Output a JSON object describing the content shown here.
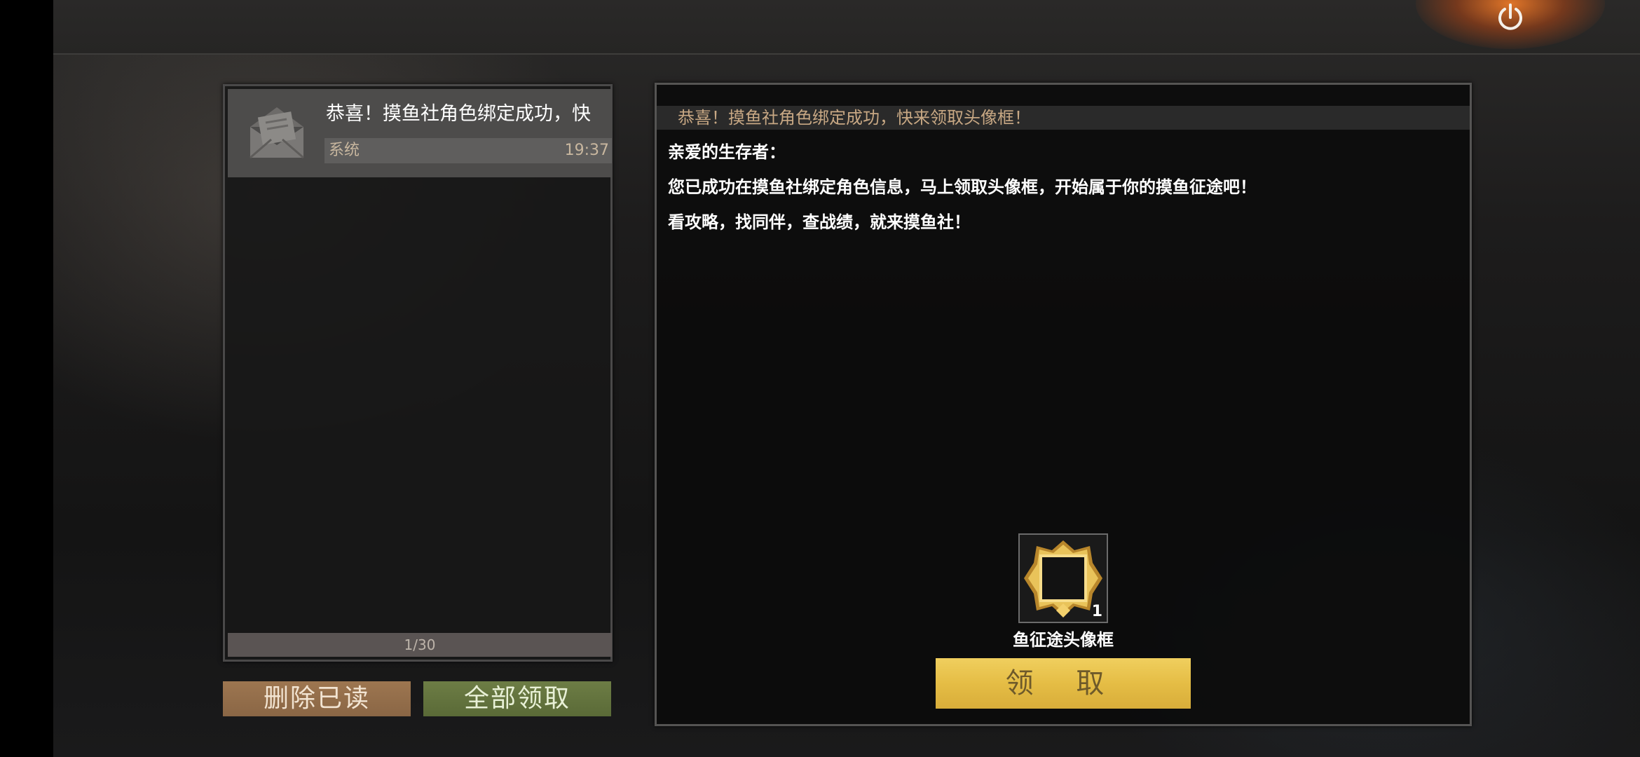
{
  "mail_list": {
    "items": [
      {
        "title": "恭喜！摸鱼社角色绑定成功，快",
        "sender": "系统",
        "time": "19:37"
      }
    ],
    "pager": "1/30"
  },
  "actions": {
    "delete_read_label": "删除已读",
    "claim_all_label": "全部领取"
  },
  "detail": {
    "title": "恭喜！摸鱼社角色绑定成功，快来领取头像框！",
    "greeting": "亲爱的生存者：",
    "body_line1": "您已成功在摸鱼社绑定角色信息，马上领取头像框，开始属于你的摸鱼征途吧！",
    "body_line2": "看攻略，找同伴，查战绩，就来摸鱼社！",
    "reward": {
      "name": "鱼征途头像框",
      "count": "1",
      "icon": "golden-avatar-frame-icon"
    },
    "claim_label": "领 取"
  },
  "topbar": {
    "power_icon": "power-icon"
  },
  "colors": {
    "claim_button": "#e5bd45",
    "delete_button": "#9d7650",
    "claim_all_button": "#6d7d45",
    "detail_title": "#c8a884"
  }
}
